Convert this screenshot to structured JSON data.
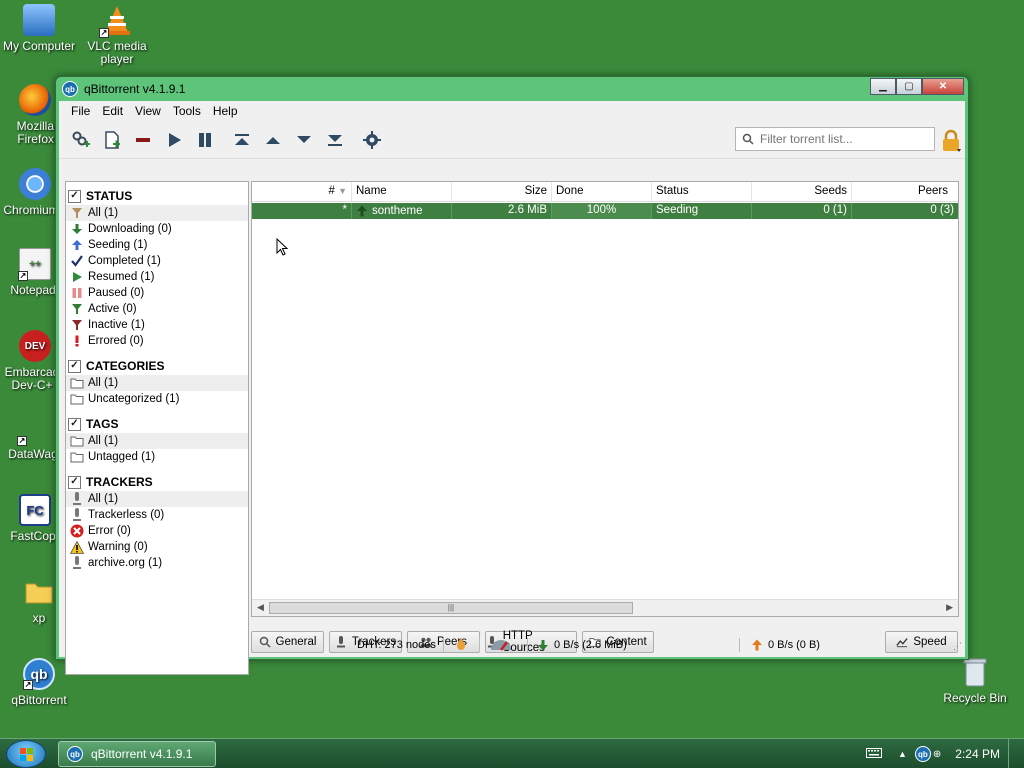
{
  "desktop": {
    "icons": [
      {
        "label": "My Computer",
        "icon": "computer-icon"
      },
      {
        "label": "VLC media player",
        "icon": "vlc-cone-icon"
      },
      {
        "label": "Mozilla Firefox",
        "icon": "firefox-icon"
      },
      {
        "label": "Chromium",
        "icon": "chromium-icon"
      },
      {
        "label": "Notepad++",
        "icon": "notepad-icon"
      },
      {
        "label": "Embarcadero Dev-C++",
        "icon": "devcpp-icon"
      },
      {
        "label": "DataWagon",
        "icon": "datawagon-icon"
      },
      {
        "label": "FastCopy",
        "icon": "fastcopy-icon"
      },
      {
        "label": "xp",
        "icon": "folder-icon"
      },
      {
        "label": "qBittorrent",
        "icon": "qbittorrent-icon"
      },
      {
        "label": "Recycle Bin",
        "icon": "recycle-bin-icon"
      }
    ],
    "icon_short_labels": {
      "firefox": "Mozilla\nFirefox",
      "chromium": "Chromium",
      "notepad": "Notepad",
      "devcpp": "Embarcad\nDev-C+",
      "datawagon": "DataWag",
      "fastcopy": "FastCop"
    }
  },
  "window": {
    "title": "qBittorrent v4.1.9.1",
    "menu": [
      "File",
      "Edit",
      "View",
      "Tools",
      "Help"
    ],
    "filter_placeholder": "Filter torrent list...",
    "sidebar": {
      "status": {
        "title": "STATUS",
        "items": [
          {
            "label": "All (1)",
            "icon": "all-filter-icon",
            "selected": true
          },
          {
            "label": "Downloading (0)",
            "icon": "download-arrow-icon"
          },
          {
            "label": "Seeding (1)",
            "icon": "upload-arrow-icon"
          },
          {
            "label": "Completed (1)",
            "icon": "checkmark-icon"
          },
          {
            "label": "Resumed (1)",
            "icon": "play-icon"
          },
          {
            "label": "Paused (0)",
            "icon": "pause-icon"
          },
          {
            "label": "Active (0)",
            "icon": "active-filter-icon"
          },
          {
            "label": "Inactive (1)",
            "icon": "inactive-filter-icon"
          },
          {
            "label": "Errored (0)",
            "icon": "error-exclamation-icon"
          }
        ]
      },
      "categories": {
        "title": "CATEGORIES",
        "items": [
          {
            "label": "All (1)",
            "icon": "folder-icon",
            "selected": true
          },
          {
            "label": "Uncategorized (1)",
            "icon": "folder-icon"
          }
        ]
      },
      "tags": {
        "title": "TAGS",
        "items": [
          {
            "label": "All (1)",
            "icon": "folder-icon",
            "selected": true
          },
          {
            "label": "Untagged (1)",
            "icon": "folder-icon"
          }
        ]
      },
      "trackers": {
        "title": "TRACKERS",
        "items": [
          {
            "label": "All (1)",
            "icon": "tracker-icon",
            "selected": true
          },
          {
            "label": "Trackerless (0)",
            "icon": "tracker-icon"
          },
          {
            "label": "Error (0)",
            "icon": "error-circle-icon"
          },
          {
            "label": "Warning (0)",
            "icon": "warning-triangle-icon"
          },
          {
            "label": "archive.org (1)",
            "icon": "tracker-icon"
          }
        ]
      }
    },
    "table": {
      "columns": [
        "#",
        "Name",
        "Size",
        "Done",
        "Status",
        "Seeds",
        "Peers"
      ],
      "rows": [
        {
          "num": "*",
          "name": "sontheme",
          "size": "2.6 MiB",
          "done": "100%",
          "status": "Seeding",
          "seeds": "0 (1)",
          "peers": "0 (3)"
        }
      ]
    },
    "bottom_tabs": [
      "General",
      "Trackers",
      "Peers",
      "HTTP Sources",
      "Content"
    ],
    "speed_button": "Speed",
    "statusbar": {
      "dht": "DHT: 273 nodes",
      "download": "0 B/s (2.6 MiB)",
      "upload": "0 B/s (0 B)"
    }
  },
  "taskbar": {
    "task_label": "qBittorrent v4.1.9.1",
    "time": "2:24 PM"
  },
  "colors": {
    "desktop_bg": "#3a8a3a",
    "row_selected": "#3f7f41",
    "accent_blue": "#1b6fb0"
  }
}
